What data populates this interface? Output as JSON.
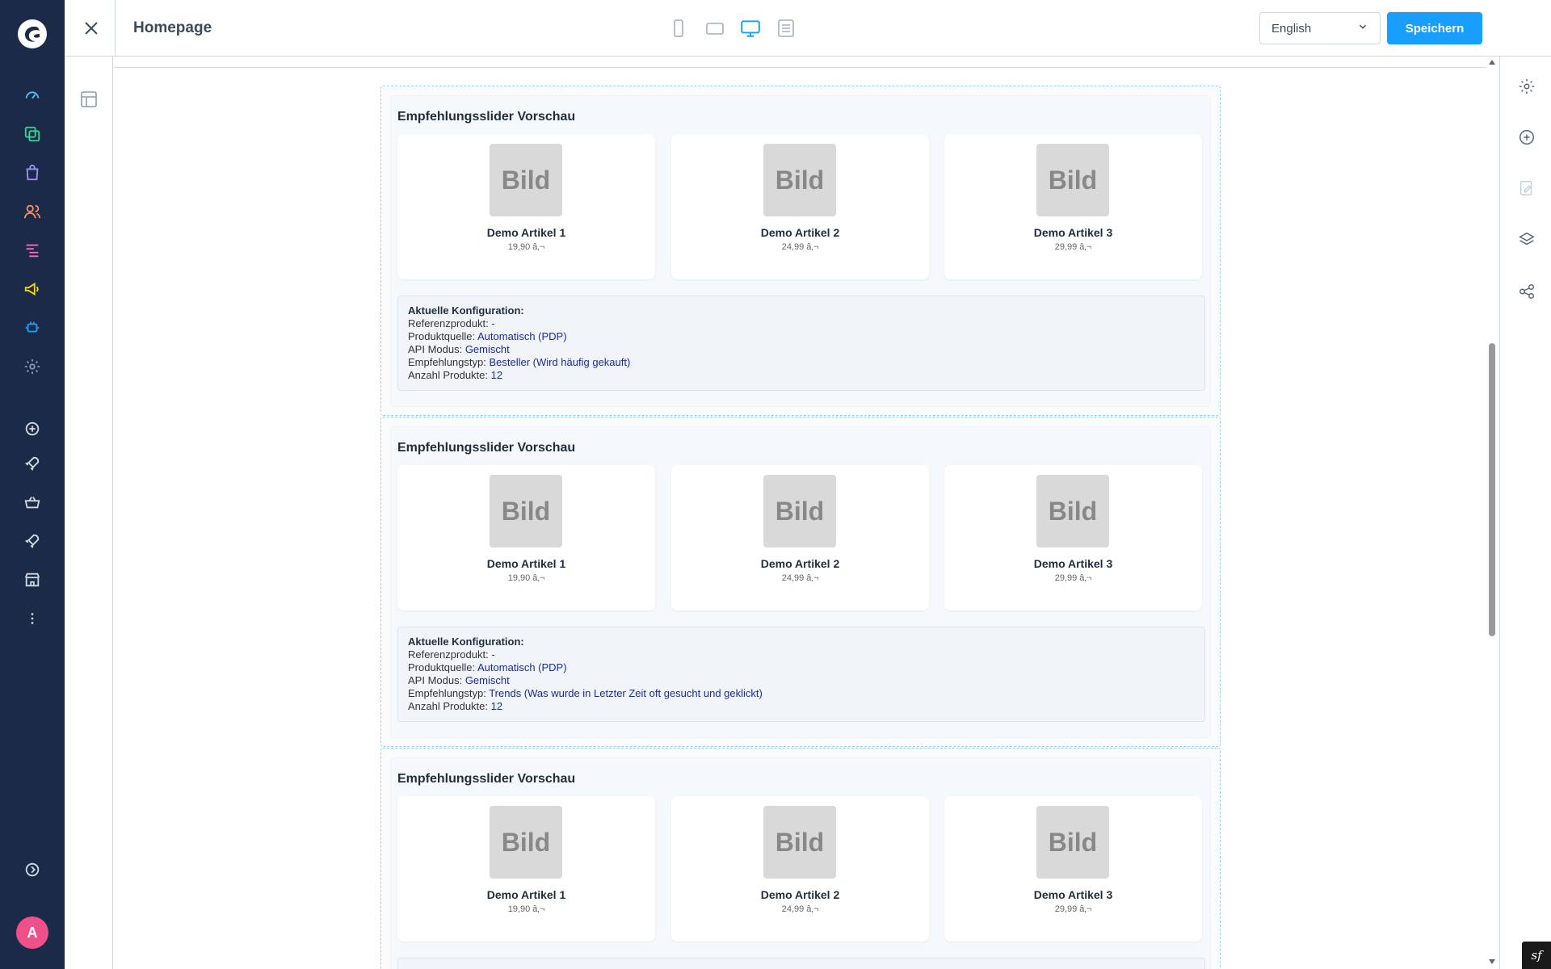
{
  "topbar": {
    "title": "Homepage",
    "language": "English",
    "save_label": "Speichern"
  },
  "user": {
    "avatar_initial": "A"
  },
  "symfony_badge": "sf",
  "colors": {
    "sidebar_bg": "#1b2b47",
    "primary": "#189eff",
    "avatar": "#f0508a",
    "config_value": "#1a2b9e"
  },
  "scroll": {
    "position_fraction": 0.31,
    "visible_fraction": 0.33
  },
  "sections": [
    {
      "title": "Empfehlungsslider Vorschau",
      "products": [
        {
          "image_label": "Bild",
          "name": "Demo Artikel 1",
          "price": "19,90 â‚¬"
        },
        {
          "image_label": "Bild",
          "name": "Demo Artikel 2",
          "price": "24,99 â‚¬"
        },
        {
          "image_label": "Bild",
          "name": "Demo Artikel 3",
          "price": "29,99 â‚¬"
        }
      ],
      "config": {
        "heading": "Aktuelle Konfiguration:",
        "rows": [
          {
            "label": "Referenzprodukt: ",
            "value": "-"
          },
          {
            "label": "Produktquelle: ",
            "value": "Automatisch (PDP)"
          },
          {
            "label": "API Modus: ",
            "value": "Gemischt"
          },
          {
            "label": "Empfehlungstyp: ",
            "value": "Besteller (Wird häufig gekauft)"
          },
          {
            "label": "Anzahl Produkte: ",
            "value": "12"
          }
        ]
      }
    },
    {
      "title": "Empfehlungsslider Vorschau",
      "products": [
        {
          "image_label": "Bild",
          "name": "Demo Artikel 1",
          "price": "19,90 â‚¬"
        },
        {
          "image_label": "Bild",
          "name": "Demo Artikel 2",
          "price": "24,99 â‚¬"
        },
        {
          "image_label": "Bild",
          "name": "Demo Artikel 3",
          "price": "29,99 â‚¬"
        }
      ],
      "config": {
        "heading": "Aktuelle Konfiguration:",
        "rows": [
          {
            "label": "Referenzprodukt: ",
            "value": "-"
          },
          {
            "label": "Produktquelle: ",
            "value": "Automatisch (PDP)"
          },
          {
            "label": "API Modus: ",
            "value": "Gemischt"
          },
          {
            "label": "Empfehlungstyp: ",
            "value": "Trends (Was wurde in Letzter Zeit oft gesucht und geklickt)"
          },
          {
            "label": "Anzahl Produkte: ",
            "value": "12"
          }
        ]
      }
    },
    {
      "title": "Empfehlungsslider Vorschau",
      "products": [
        {
          "image_label": "Bild",
          "name": "Demo Artikel 1",
          "price": "19,90 â‚¬"
        },
        {
          "image_label": "Bild",
          "name": "Demo Artikel 2",
          "price": "24,99 â‚¬"
        },
        {
          "image_label": "Bild",
          "name": "Demo Artikel 3",
          "price": "29,99 â‚¬"
        }
      ],
      "config": null
    }
  ]
}
